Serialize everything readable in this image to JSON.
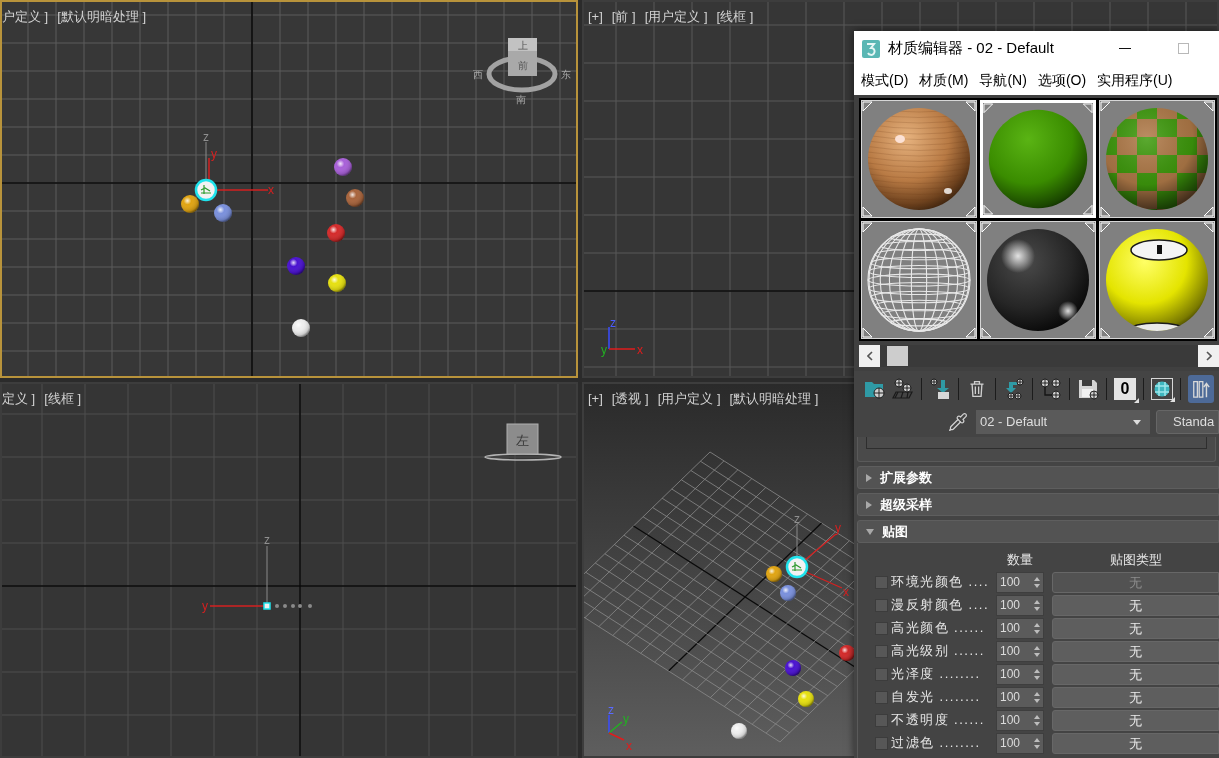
{
  "viewports": [
    {
      "kind": "top",
      "active": true,
      "labels": [
        "户定义 ]",
        "[默认明暗处理 ]"
      ],
      "gizmo_labels": {
        "z": "z",
        "y": "y",
        "x": "x"
      },
      "viewcube_labels": {
        "top": "上",
        "front": "前",
        "west": "西",
        "east": "东",
        "south": "南"
      }
    },
    {
      "kind": "front",
      "active": false,
      "labels": [
        "[+]",
        "[前 ]",
        "[用户定义 ]",
        "[线框 ]"
      ],
      "tripod_labels": {
        "z": "z",
        "y": "y",
        "x": "x"
      }
    },
    {
      "kind": "left",
      "active": false,
      "labels": [
        "定义 ]",
        "[线框 ]"
      ],
      "gizmo_labels": {
        "z": "z",
        "y": "y"
      },
      "viewcube_labels": {
        "front": "左"
      }
    },
    {
      "kind": "perspective",
      "active": false,
      "labels": [
        "[+]",
        "[透视 ]",
        "[用户定义 ]",
        "[默认明暗处理 ]"
      ],
      "gizmo_labels": {
        "z": "z",
        "y": "y",
        "x": "x"
      },
      "tripod_labels": {
        "z": "z",
        "y": "y",
        "x": "x"
      }
    }
  ],
  "material_editor": {
    "title": "材质编辑器 - 02 - Default",
    "menu": [
      "模式(D)",
      "材质(M)",
      "导航(N)",
      "选项(O)",
      "实用程序(U)"
    ],
    "slots": [
      {
        "kind": "wood",
        "selected": false
      },
      {
        "kind": "matte",
        "selected": true
      },
      {
        "kind": "checker",
        "selected": false
      },
      {
        "kind": "wire",
        "selected": false
      },
      {
        "kind": "glossy",
        "selected": false
      },
      {
        "kind": "ball",
        "selected": false
      }
    ],
    "toolbar": {
      "channel_button": "0",
      "toggle_on": true
    },
    "material_name": "02 - Default",
    "type_button": "Standa",
    "rollouts": [
      {
        "title": "扩展参数",
        "expanded": false
      },
      {
        "title": "超级采样",
        "expanded": false
      },
      {
        "title": "贴图",
        "expanded": true
      }
    ],
    "maps": {
      "columns": [
        "数量",
        "贴图类型"
      ],
      "rows": [
        {
          "label": "环境光颜色 ....",
          "checked": false,
          "amount": "100",
          "map": "无",
          "disabled": true
        },
        {
          "label": "漫反射颜色 ....",
          "checked": false,
          "amount": "100",
          "map": "无",
          "disabled": false
        },
        {
          "label": "高光颜色 ......",
          "checked": false,
          "amount": "100",
          "map": "无",
          "disabled": false
        },
        {
          "label": "高光级别 ......",
          "checked": false,
          "amount": "100",
          "map": "无",
          "disabled": false
        },
        {
          "label": "光泽度 ........",
          "checked": false,
          "amount": "100",
          "map": "无",
          "disabled": false
        },
        {
          "label": "自发光 ........",
          "checked": false,
          "amount": "100",
          "map": "无",
          "disabled": false
        },
        {
          "label": "不透明度 ......",
          "checked": false,
          "amount": "100",
          "map": "无",
          "disabled": false
        },
        {
          "label": "过滤色 ........",
          "checked": false,
          "amount": "100",
          "map": "无",
          "disabled": false
        }
      ]
    }
  }
}
